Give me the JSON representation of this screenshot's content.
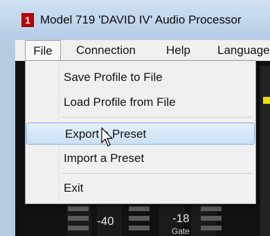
{
  "window": {
    "title": "Model 719 'DAVID IV' Audio Processor",
    "icon": "app-icon",
    "icon_glyph": "1"
  },
  "menubar": {
    "items": [
      {
        "label": "File"
      },
      {
        "label": "Connection"
      },
      {
        "label": "Help"
      },
      {
        "label": "Language"
      }
    ]
  },
  "file_menu": {
    "items": [
      {
        "label": "Save Profile to File"
      },
      {
        "label": "Load Profile from File"
      },
      {
        "label": "Export a Preset",
        "highlighted": true
      },
      {
        "label": "Import a Preset"
      },
      {
        "label": "Exit"
      }
    ]
  },
  "meters": {
    "label_left": "-40",
    "label_right": "-18",
    "label_gate": "Gate"
  },
  "colors": {
    "highlight": "#cce0f6",
    "meter_indicator": "#f0e000",
    "app_background": "#111111"
  }
}
